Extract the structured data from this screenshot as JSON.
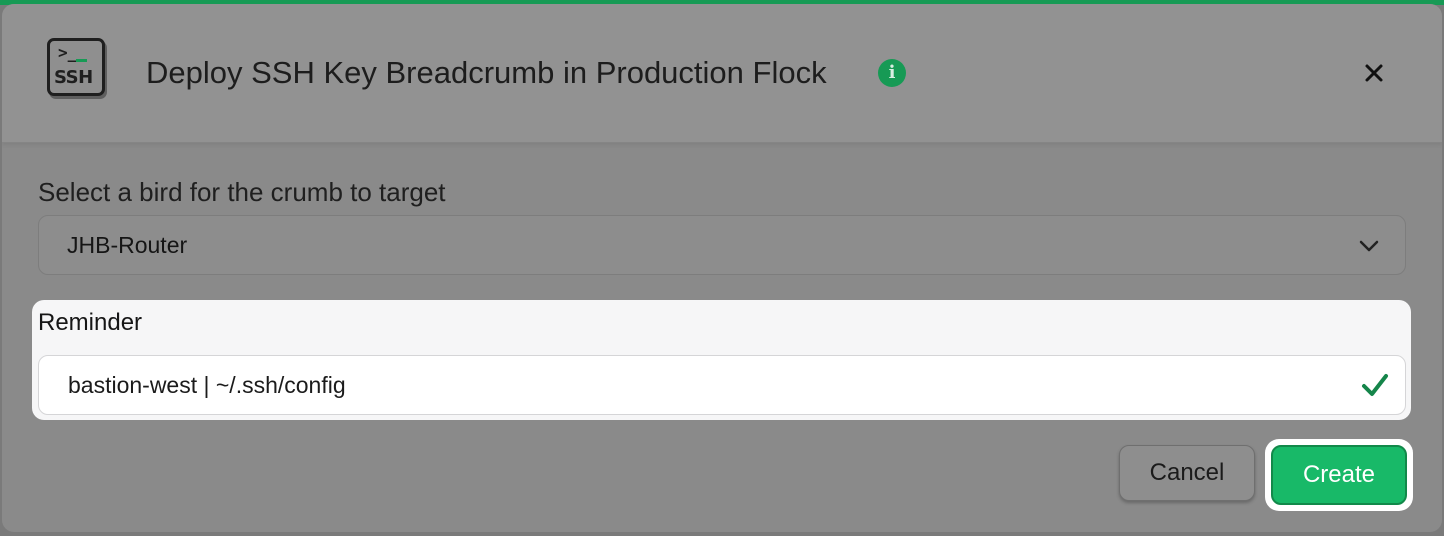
{
  "colors": {
    "accent": "#179a55",
    "primary_button": "#18b968",
    "overlay": "#8a8a8a",
    "highlight_panel": "#f6f6f7"
  },
  "dialog": {
    "icon_prompt": ">_",
    "icon_label": "SSH",
    "title": "Deploy SSH Key Breadcrumb in Production Flock",
    "info_icon": "info-icon",
    "info_glyph": "i",
    "close_icon": "close-icon"
  },
  "target_field": {
    "label": "Select a bird for the crumb to target",
    "selected_value": "JHB-Router",
    "dropdown_icon": "chevron-down-icon"
  },
  "reminder_field": {
    "label": "Reminder",
    "value": "bastion-west | ~/.ssh/config",
    "valid_icon": "check-icon"
  },
  "actions": {
    "cancel_label": "Cancel",
    "create_label": "Create"
  }
}
